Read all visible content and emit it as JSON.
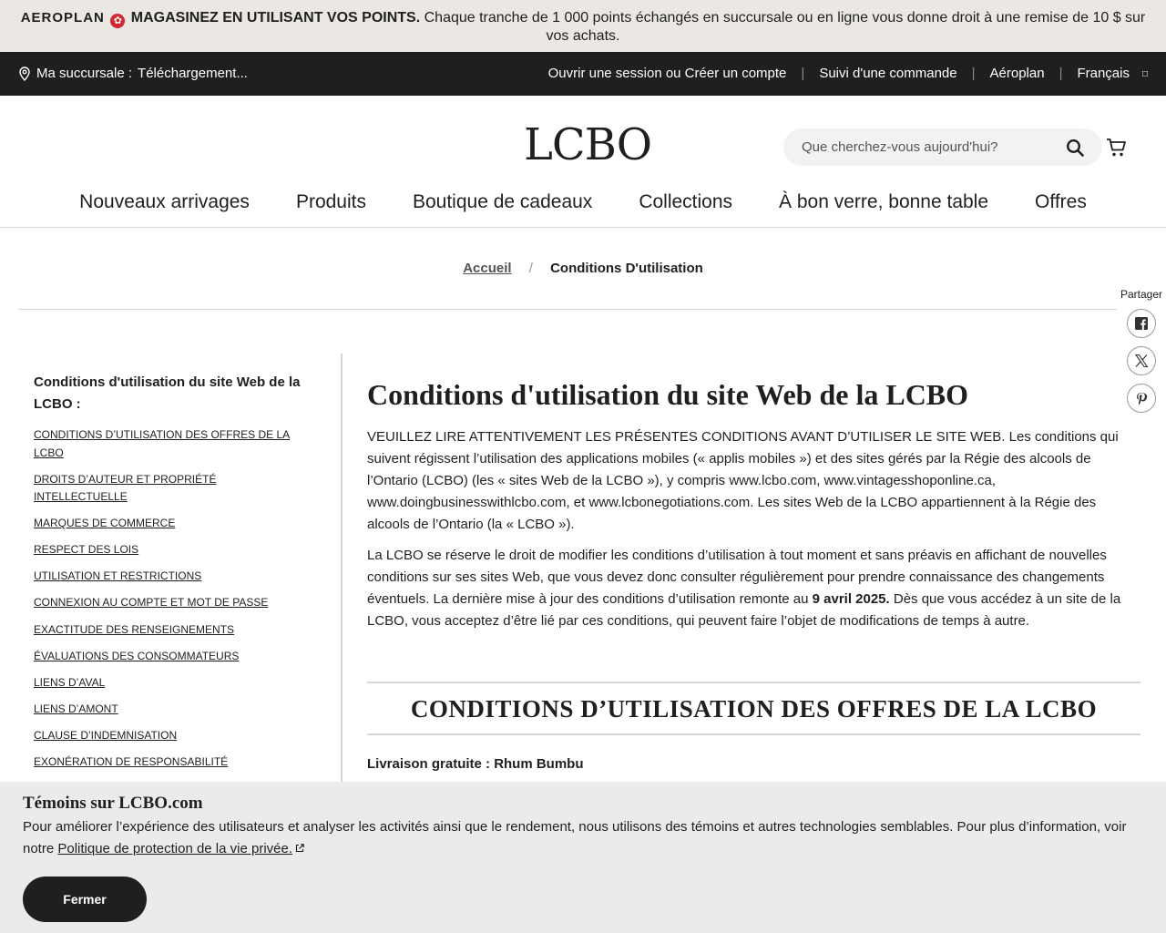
{
  "promo": {
    "brand": "AEROPLAN",
    "headline": "MAGASINEZ EN UTILISANT VOS POINTS.",
    "text": "Chaque tranche de 1 000 points échangés en succursale ou en ligne vous donne droit à une remise de 10 $ sur vos achats."
  },
  "utility": {
    "store_label": "Ma succursale :",
    "store_value": "Téléchargement...",
    "links": [
      "Ouvrir une session ou Créer un compte",
      "Suivi d'une commande",
      "Aéroplan",
      "Français"
    ]
  },
  "header": {
    "logo": "LCBO",
    "search_placeholder": "Que cherchez-vous aujourd'hui?"
  },
  "nav": [
    "Nouveaux arrivages",
    "Produits",
    "Boutique de cadeaux",
    "Collections",
    "À bon verre, bonne table",
    "Offres"
  ],
  "breadcrumb": {
    "home": "Accueil",
    "separator": "/",
    "current": "Conditions D'utilisation"
  },
  "share": {
    "label": "Partager"
  },
  "sidebar": {
    "title": "Conditions d'utilisation du site Web de la LCBO :",
    "items": [
      "CONDITIONS D’UTILISATION DES OFFRES DE LA LCBO",
      "DROITS D’AUTEUR ET PROPRIÉTÉ INTELLECTUELLE",
      "MARQUES DE COMMERCE",
      "RESPECT DES LOIS",
      "UTILISATION ET RESTRICTIONS",
      "CONNEXION AU COMPTE ET MOT DE PASSE",
      "EXACTITUDE DES RENSEIGNEMENTS",
      "ÉVALUATIONS DES CONSOMMATEURS",
      "LIENS D’AVAL",
      "LIENS D’AMONT",
      "CLAUSE D’INDEMNISATION",
      "EXONÉRATION DE RESPONSABILITÉ"
    ]
  },
  "main": {
    "title": "Conditions d'utilisation du site Web de la LCBO",
    "para1": "VEUILLEZ LIRE ATTENTIVEMENT LES PRÉSENTES CONDITIONS AVANT D’UTILISER LE SITE WEB. Les conditions qui suivent régissent l’utilisation des applications mobiles (« applis mobiles ») et des sites gérés par la Régie des alcools de l’Ontario (LCBO) (les « sites Web de la LCBO »), y compris www.lcbo.com, www.vintagesshoponline.ca, www.doingbusinesswithlcbo.com, et www.lcbonegotiations.com. Les sites Web de la LCBO appartiennent à la Régie des alcools de l’Ontario (la « LCBO »).",
    "para2_before": "La LCBO se réserve le droit de modifier les conditions d’utilisation à tout moment et sans préavis en affichant de nouvelles conditions sur ses sites Web, que vous devez donc consulter régulièrement pour prendre connaissance des changements éventuels. La dernière mise à jour des conditions d’utilisation remonte au ",
    "para2_date": "9 avril 2025.",
    "para2_after": " Dès que vous accédez à un site de la LCBO, vous acceptez d’être lié par ces conditions, qui peuvent faire l’objet de modifications de temps à autre.",
    "section_title": "CONDITIONS D’UTILISATION DES OFFRES DE LA LCBO",
    "free_shipping": "Livraison gratuite : Rhum Bumbu"
  },
  "cookie": {
    "title": "Témoins sur LCBO.com",
    "text": "Pour améliorer l’expérience des utilisateurs et analyser les activités ainsi que le rendement, nous utilisons des témoins et autres technologies semblables. Pour plus d’information, voir notre ",
    "link": "Politique de protection de la vie privée.",
    "button": "Fermer"
  }
}
